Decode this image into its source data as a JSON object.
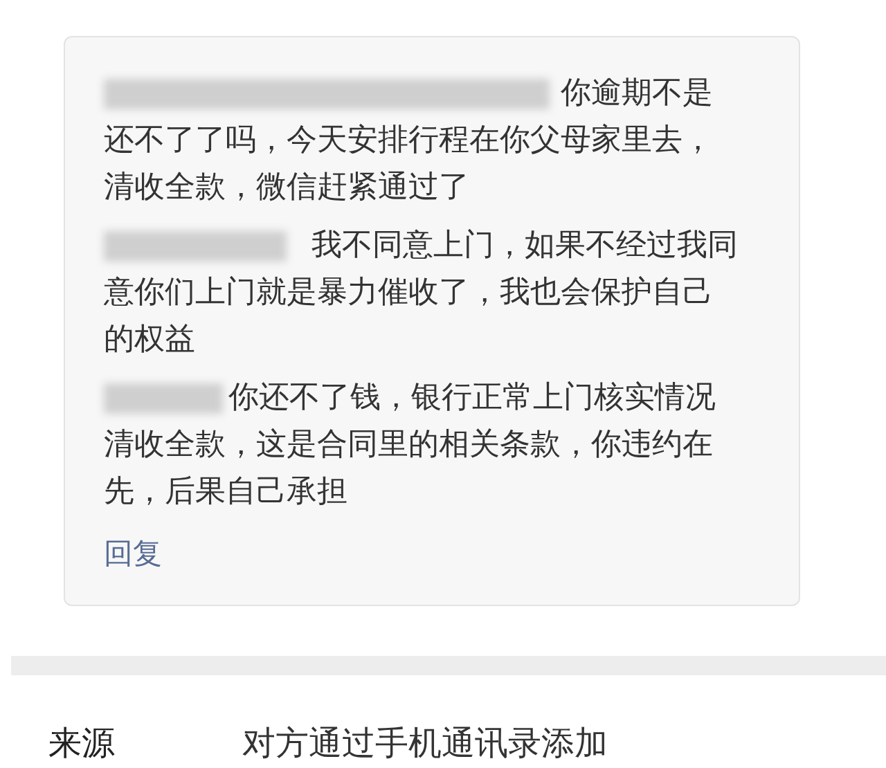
{
  "messages": [
    {
      "lines": [
        "你逾期不是",
        "还不了了吗，今天安排行程在你父母家里去，",
        "清收全款，微信赶紧通过了"
      ]
    },
    {
      "lines": [
        "我不同意上门，如果不经过我同",
        "意你们上门就是暴力催收了，我也会保护自己",
        "的权益"
      ]
    },
    {
      "lines": [
        "你还不了钱，银行正常上门核实情况",
        "清收全款，这是合同里的相关条款，你违约在",
        "先，后果自己承担"
      ]
    }
  ],
  "reply_link": "回复",
  "source": {
    "label": "来源",
    "value": "对方通过手机通讯录添加"
  }
}
